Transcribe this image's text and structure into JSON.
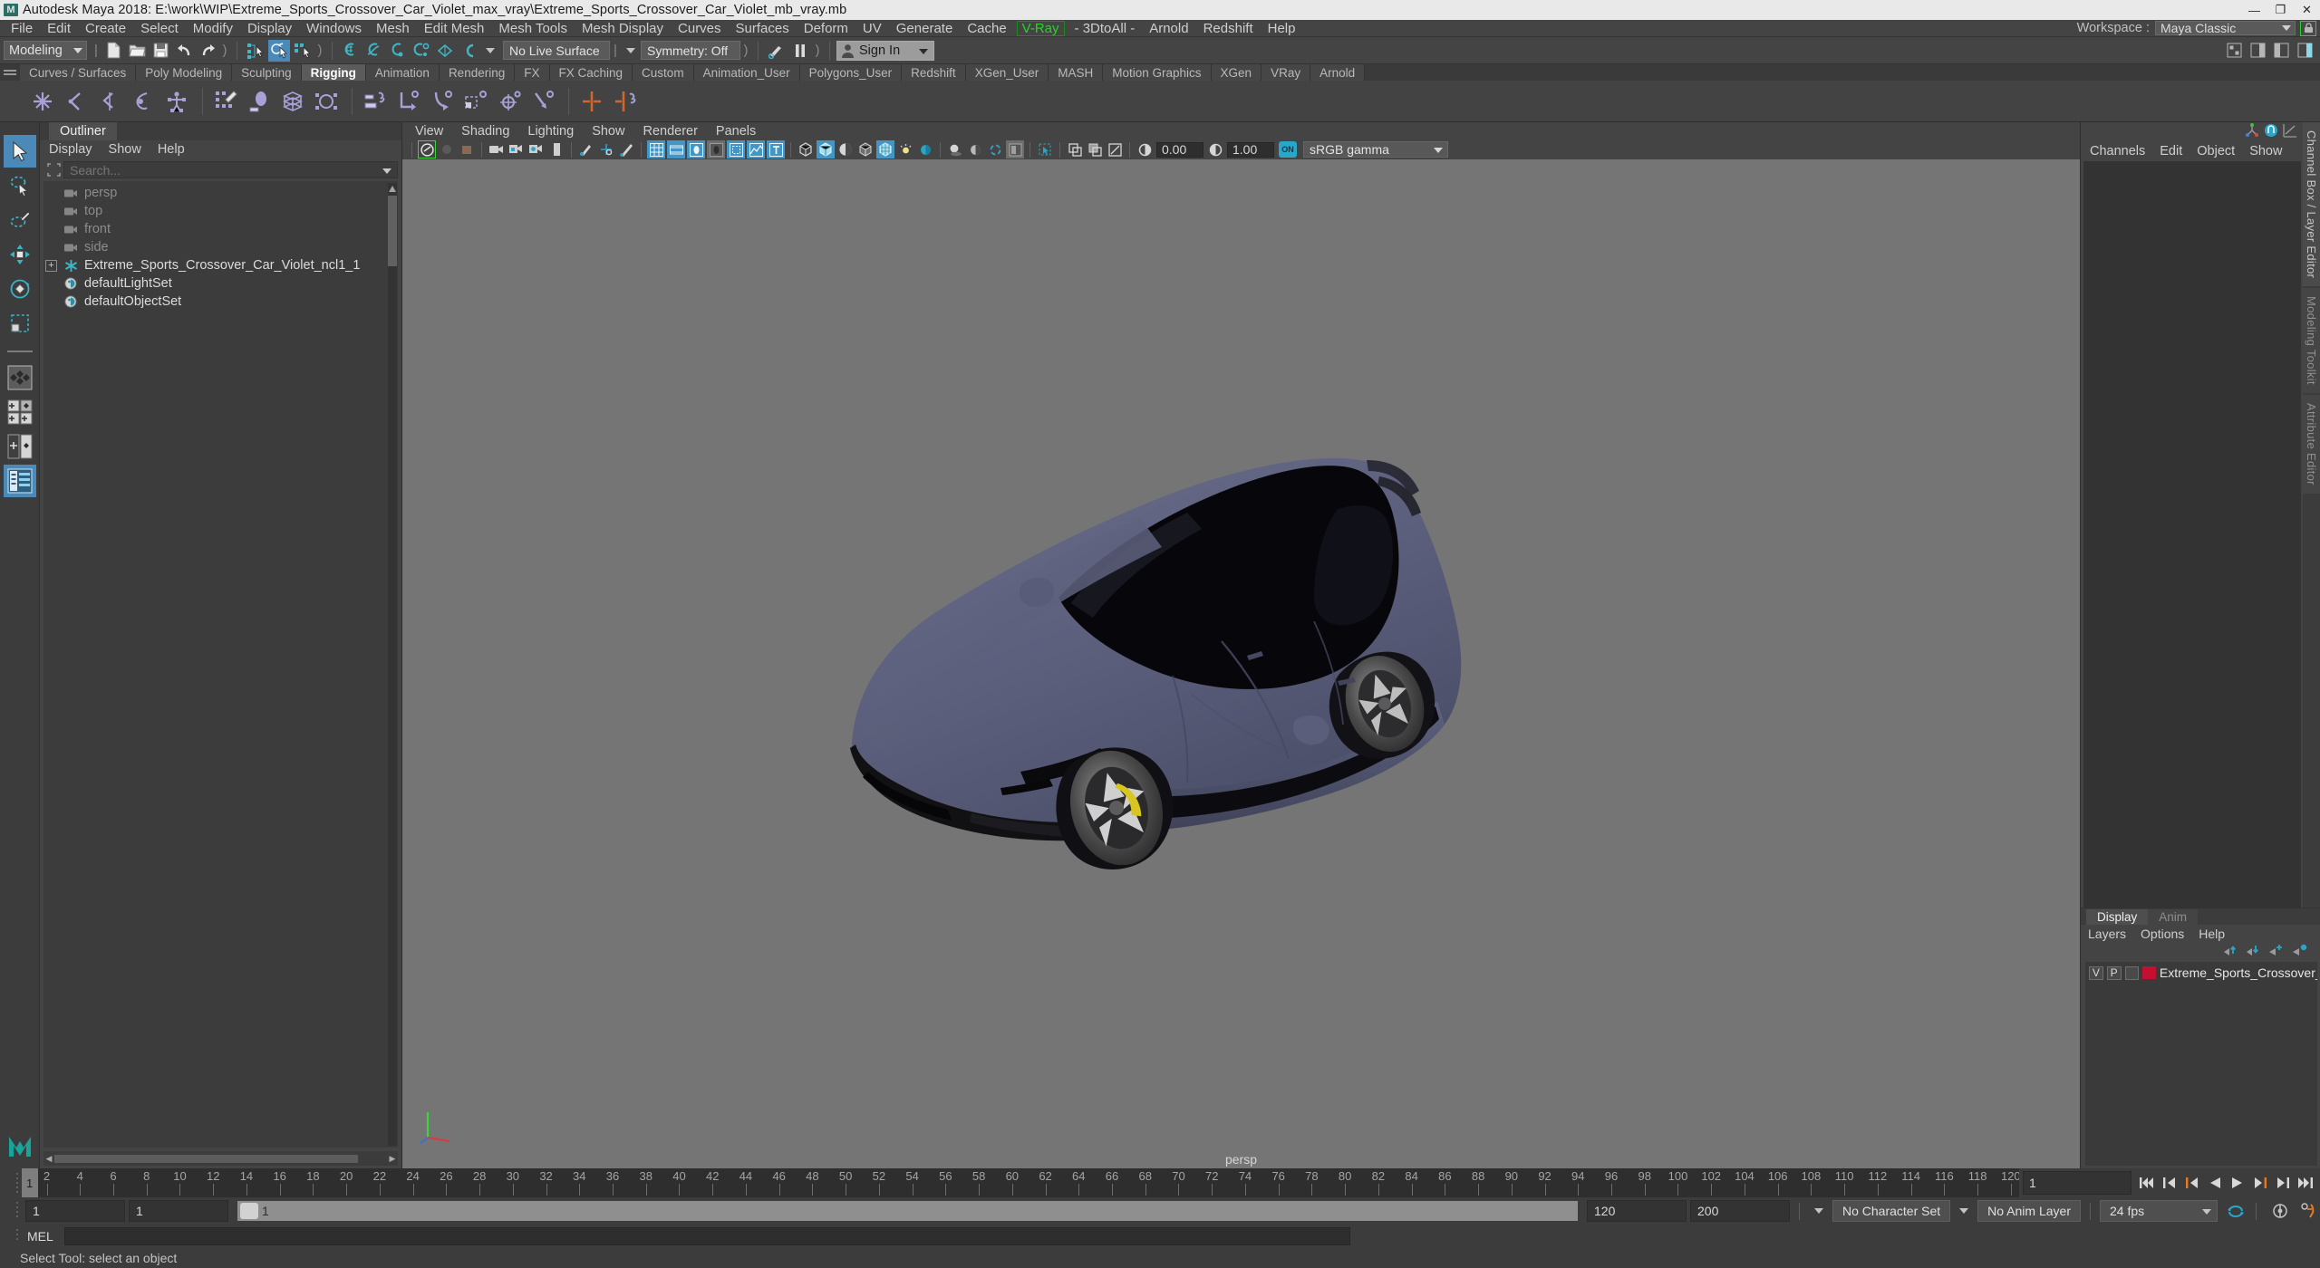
{
  "window": {
    "title": "Autodesk Maya 2018: E:\\work\\WIP\\Extreme_Sports_Crossover_Car_Violet_max_vray\\Extreme_Sports_Crossover_Car_Violet_mb_vray.mb",
    "logo": "M",
    "minimize": "—",
    "maximize": "❐",
    "close": "✕"
  },
  "menubar": {
    "items": [
      "File",
      "Edit",
      "Create",
      "Select",
      "Modify",
      "Display",
      "Windows",
      "Mesh",
      "Edit Mesh",
      "Mesh Tools",
      "Mesh Display",
      "Curves",
      "Surfaces",
      "Deform",
      "UV",
      "Generate",
      "Cache"
    ],
    "vray": "V-Ray",
    "items_after": [
      "- 3DtoAll -",
      "Arnold",
      "Redshift",
      "Help"
    ],
    "workspace_label": "Workspace :",
    "workspace_value": "Maya Classic",
    "lock_icon": "lock-icon"
  },
  "statusbar": {
    "menuset": "Modeling",
    "live_surface": "No Live Surface",
    "symmetry": "Symmetry: Off",
    "signin": "Sign In"
  },
  "shelf": {
    "tabs": [
      "Curves / Surfaces",
      "Poly Modeling",
      "Sculpting",
      "Rigging",
      "Animation",
      "Rendering",
      "FX",
      "FX Caching",
      "Custom",
      "Animation_User",
      "Polygons_User",
      "Redshift",
      "XGen_User",
      "MASH",
      "Motion Graphics",
      "XGen",
      "VRay",
      "Arnold"
    ],
    "active_tab": "Rigging"
  },
  "outliner": {
    "tab": "Outliner",
    "menus": [
      "Display",
      "Show",
      "Help"
    ],
    "search_placeholder": "Search...",
    "search_value": "",
    "items": [
      {
        "label": "persp",
        "icon": "camera-icon",
        "dim": true,
        "expandable": false
      },
      {
        "label": "top",
        "icon": "camera-icon",
        "dim": true,
        "expandable": false
      },
      {
        "label": "front",
        "icon": "camera-icon",
        "dim": true,
        "expandable": false
      },
      {
        "label": "side",
        "icon": "camera-icon",
        "dim": true,
        "expandable": false
      },
      {
        "label": "Extreme_Sports_Crossover_Car_Violet_ncl1_1",
        "icon": "asterisk-icon",
        "dim": false,
        "expandable": true
      },
      {
        "label": "defaultLightSet",
        "icon": "set-icon",
        "dim": false,
        "expandable": false
      },
      {
        "label": "defaultObjectSet",
        "icon": "set-icon",
        "dim": false,
        "expandable": false
      }
    ]
  },
  "viewport": {
    "menus": [
      "View",
      "Shading",
      "Lighting",
      "Show",
      "Renderer",
      "Panels"
    ],
    "exposure": "0.00",
    "gamma_value": "1.00",
    "color_space": "sRGB gamma",
    "on_badge": "ON",
    "camera_label": "persp",
    "background_color": "#757575",
    "car_body_color": "#5b5f7c",
    "car_glass_color": "#050508",
    "car_tire_color": "#151515"
  },
  "channelbox": {
    "menus": [
      "Channels",
      "Edit",
      "Object",
      "Show"
    ],
    "vertical_tabs": [
      "Channel Box / Layer Editor",
      "Modeling Toolkit",
      "Attribute Editor"
    ]
  },
  "layer_editor": {
    "tabs": [
      "Display",
      "Anim"
    ],
    "active_tab": "Display",
    "menus": [
      "Layers",
      "Options",
      "Help"
    ],
    "rows": [
      {
        "v": "V",
        "p": "P",
        "third": "",
        "color": "#c41030",
        "name": "Extreme_Sports_Crossover_Car"
      }
    ]
  },
  "timeline": {
    "start": 1,
    "end": 120,
    "current": "1",
    "tick_labels": [
      2,
      4,
      6,
      8,
      10,
      12,
      14,
      16,
      18,
      20,
      22,
      24,
      26,
      28,
      30,
      32,
      34,
      36,
      38,
      40,
      42,
      44,
      46,
      48,
      50,
      52,
      54,
      56,
      58,
      60,
      62,
      64,
      66,
      68,
      70,
      72,
      74,
      76,
      78,
      80,
      82,
      84,
      86,
      88,
      90,
      92,
      94,
      96,
      98,
      100,
      102,
      104,
      106,
      108,
      110,
      112,
      114,
      116,
      118,
      120
    ],
    "cursor_label": "1",
    "playback_current": "1"
  },
  "rangebar": {
    "range_start": "1",
    "range_end": "1",
    "slider_label": "1",
    "playback_end": "120",
    "anim_end": "200",
    "character_set": "No Character Set",
    "anim_layer": "No Anim Layer",
    "fps": "24 fps"
  },
  "command": {
    "language": "MEL",
    "value": ""
  },
  "helpline": {
    "text": "Select Tool: select an object"
  }
}
